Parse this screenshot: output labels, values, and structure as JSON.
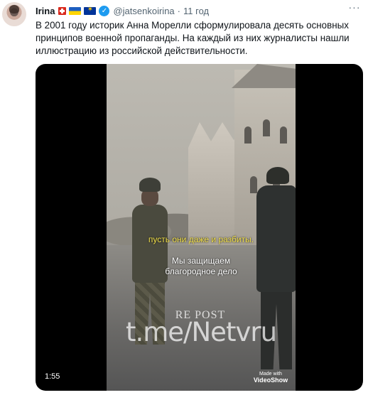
{
  "tweet": {
    "author_name": "Irina",
    "handle": "@jatsenkoirina",
    "separator": "·",
    "time": "11 год",
    "more_label": "···",
    "verified_mark": "✓",
    "text": "В 2001 году историк Анна Морелли сформулировала десять основных\nпринципов военной пропаганды. На каждый из них журналисты нашли\nиллюстрацию из российской действительности."
  },
  "video": {
    "caption_yellow": "пусть они даже и разбиты.",
    "caption_white": "Мы защищаем\nблагородное дело",
    "repost_mark": "RE POST",
    "watermark": "t.me/Netvru",
    "made_with": "Made with",
    "videoshow": "VideoShow",
    "duration": "1:55"
  },
  "colors": {
    "accent": "#1d9bf0",
    "caption_yellow": "#f2e04b",
    "secondary_text": "#536471"
  }
}
